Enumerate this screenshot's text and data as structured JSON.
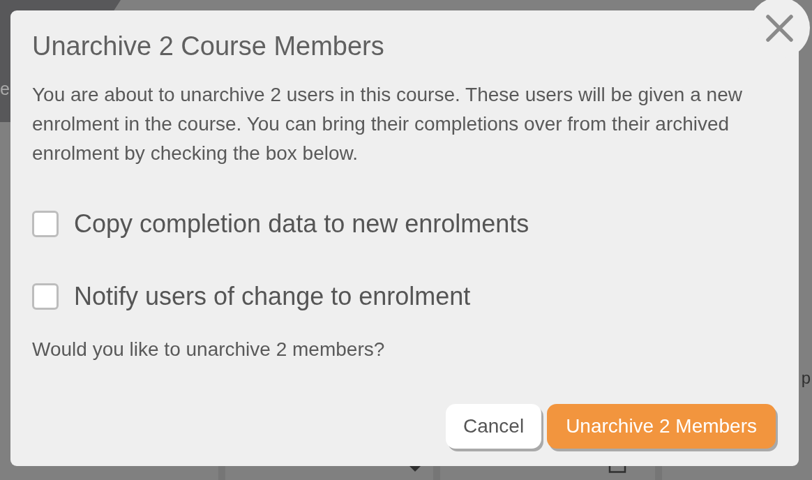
{
  "page": {
    "banner_text": "e",
    "side_text": "p"
  },
  "dialog": {
    "title": "Unarchive 2 Course Members",
    "message": "You are about to unarchive 2 users in this course. These users will be given a new enrolment in the course. You can bring their completions over from their archived enrolment by checking the box below.",
    "options": [
      {
        "label": "Copy completion data to new enrolments",
        "checked": false
      },
      {
        "label": "Notify users of change to enrolment",
        "checked": false
      }
    ],
    "question": "Would you like to unarchive 2 members?",
    "buttons": [
      {
        "label": "Cancel",
        "kind": "secondary"
      },
      {
        "label": "Unarchive 2 Members",
        "kind": "primary"
      }
    ]
  }
}
